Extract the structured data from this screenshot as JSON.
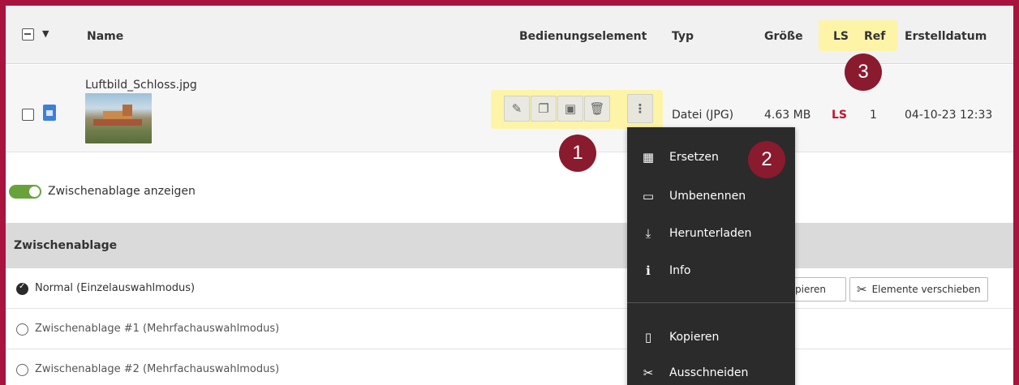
{
  "header": {
    "col_name": "Name",
    "col_controls": "Bedienungselement",
    "col_type": "Typ",
    "col_size": "Größe",
    "col_ls": "LS",
    "col_ref": "Ref",
    "col_created": "Erstelldatum"
  },
  "file": {
    "name": "Luftbild_Schloss.jpg",
    "type": "Datei (JPG)",
    "size": "4.63 MB",
    "ls": "LS",
    "ref": "1",
    "created": "04-10-23 12:33"
  },
  "badges": [
    "1",
    "2",
    "3"
  ],
  "toggle": {
    "label": "Zwischenablage anzeigen",
    "on": true
  },
  "clipboard": {
    "title": "Zwischenablage",
    "modes": [
      {
        "label": "Normal (Einzelauswahlmodus)",
        "selected": true
      },
      {
        "label": "Zwischenablage #1 (Mehrfachauswahlmodus)",
        "selected": false
      },
      {
        "label": "Zwischenablage #2 (Mehrfachauswahlmodus)",
        "selected": false
      }
    ],
    "copy_label": "Elemente kopieren",
    "copy_visible": "pieren",
    "move_label": "Elemente verschieben"
  },
  "menu": {
    "items": [
      {
        "label": "Ersetzen",
        "icon": "replace-icon"
      },
      {
        "label": "Umbenennen",
        "icon": "rename-icon"
      },
      {
        "label": "Herunterladen",
        "icon": "download-icon"
      },
      {
        "label": "Info",
        "icon": "info-icon"
      },
      {
        "label": "Kopieren",
        "icon": "copy-icon"
      },
      {
        "label": "Ausschneiden",
        "icon": "cut-icon"
      }
    ]
  },
  "colors": {
    "frame": "#a8143d",
    "badge": "#8a1a2e",
    "highlight": "#fdf4a8",
    "toggle": "#67a33a",
    "ls_red": "#c8102e",
    "menu_bg": "#2b2b2b"
  }
}
